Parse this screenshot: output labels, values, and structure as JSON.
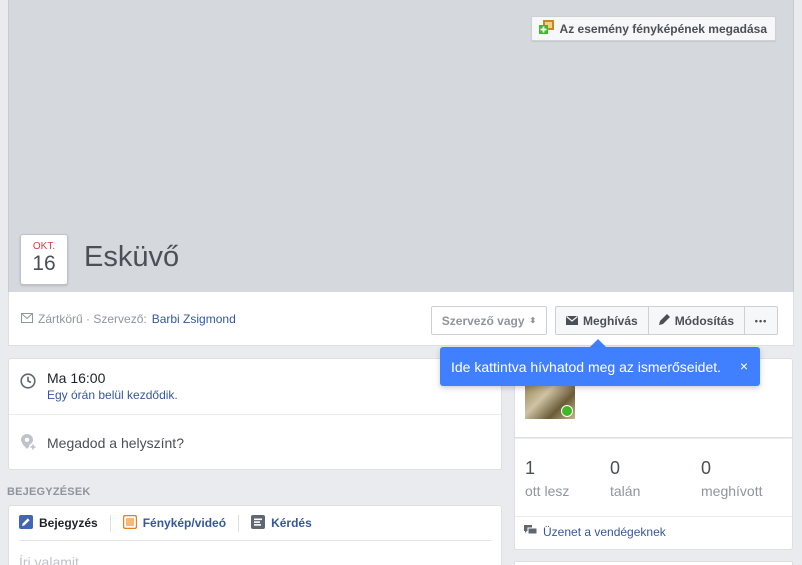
{
  "cover": {
    "add_photo_label": "Az esemény fényképének megadása"
  },
  "event": {
    "month": "OKT.",
    "day": "16",
    "title": "Esküvő"
  },
  "info_bar": {
    "privacy_prefix": "Zártkörű · Szervező:",
    "organizer": "Barbi Zsigmond",
    "host_button": "Szervező vagy",
    "invite_button": "Meghívás",
    "edit_button": "Módosítás",
    "more_button": "•••"
  },
  "tooltip": {
    "text": "Ide kattintva hívhatod meg az ismerőseidet.",
    "close": "×"
  },
  "details": {
    "time": "Ma 16:00",
    "time_sub": "Egy órán belül kezdődik.",
    "location_prompt": "Megadod a helyszínt?"
  },
  "posts": {
    "heading": "BEJEGYZÉSEK",
    "tabs": [
      "Bejegyzés",
      "Fénykép/videó",
      "Kérdés"
    ],
    "placeholder": "Írj valamit..."
  },
  "guests": {
    "stats": [
      {
        "count": "1",
        "label": "ott lesz"
      },
      {
        "count": "0",
        "label": "talán"
      },
      {
        "count": "0",
        "label": "meghívott"
      }
    ],
    "message_label": "Üzenet a vendégeknek"
  },
  "colors": {
    "accent": "#4080ff",
    "link": "#365899",
    "date_month": "#e0393e"
  }
}
